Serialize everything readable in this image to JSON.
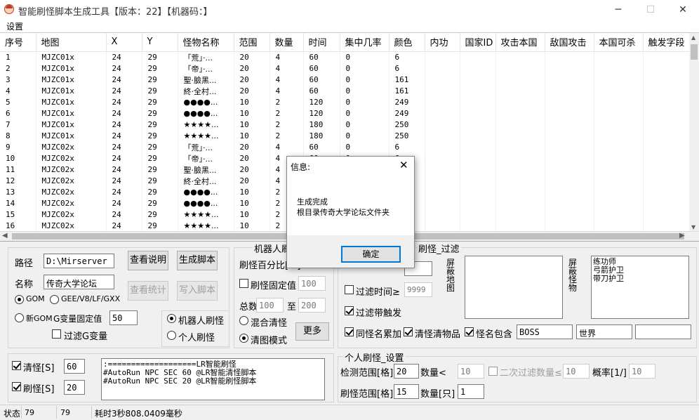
{
  "window": {
    "title": "智能刷怪脚本生成工具【版本：22】【机器码：】"
  },
  "menu": {
    "settings": "设置"
  },
  "table": {
    "columns": [
      "序号",
      "地图",
      "X",
      "Y",
      "怪物名称",
      "范围",
      "数量",
      "时间",
      "集中几率",
      "颜色",
      "内功",
      "国家ID",
      "攻击本国",
      "敌国攻击",
      "本国可杀",
      "触发字段"
    ],
    "rows": [
      [
        "1",
        "MJZC01x",
        "24",
        "29",
        "「荒」·...",
        "20",
        "4",
        "60",
        "0",
        "6"
      ],
      [
        "2",
        "MJZC01x",
        "24",
        "29",
        "「帝」·...",
        "20",
        "4",
        "60",
        "0",
        "6"
      ],
      [
        "3",
        "MJZC01x",
        "24",
        "29",
        "聖·臉黑...",
        "20",
        "4",
        "60",
        "0",
        "161"
      ],
      [
        "4",
        "MJZC01x",
        "24",
        "29",
        "終·全村...",
        "20",
        "4",
        "60",
        "0",
        "161"
      ],
      [
        "5",
        "MJZC01x",
        "24",
        "29",
        "●●●●...",
        "10",
        "2",
        "120",
        "0",
        "249"
      ],
      [
        "6",
        "MJZC01x",
        "24",
        "29",
        "●●●●...",
        "10",
        "2",
        "120",
        "0",
        "249"
      ],
      [
        "7",
        "MJZC01x",
        "24",
        "29",
        "★★★★...",
        "10",
        "2",
        "180",
        "0",
        "250"
      ],
      [
        "8",
        "MJZC01x",
        "24",
        "29",
        "★★★★...",
        "10",
        "2",
        "180",
        "0",
        "250"
      ],
      [
        "9",
        "MJZC02x",
        "24",
        "29",
        "「荒」·...",
        "20",
        "4",
        "60",
        "0",
        "6"
      ],
      [
        "10",
        "MJZC02x",
        "24",
        "29",
        "「帝」·...",
        "20",
        "4",
        "60",
        "0",
        "6"
      ],
      [
        "11",
        "MJZC02x",
        "24",
        "29",
        "聖·臉黑...",
        "20",
        "4",
        "60",
        "0",
        "161"
      ],
      [
        "12",
        "MJZC02x",
        "24",
        "29",
        "終·全村...",
        "20",
        "4",
        "60",
        "0",
        "161"
      ],
      [
        "13",
        "MJZC02x",
        "24",
        "29",
        "●●●●...",
        "10",
        "2",
        "120",
        "0",
        "249"
      ],
      [
        "14",
        "MJZC02x",
        "24",
        "29",
        "●●●●...",
        "10",
        "2",
        "120",
        "0",
        "249"
      ],
      [
        "15",
        "MJZC02x",
        "24",
        "29",
        "★★★★...",
        "10",
        "2",
        "180",
        "0",
        "250"
      ],
      [
        "16",
        "MJZC02x",
        "24",
        "29",
        "★★★★...",
        "10",
        "2",
        "180",
        "0",
        "250"
      ]
    ]
  },
  "config": {
    "path_label": "路径",
    "path_value": "D:\\Mirserver",
    "name_label": "名称",
    "name_value": "传奇大学论坛",
    "btn_view_help": "查看说明",
    "btn_gen_script": "生成脚本",
    "btn_stats": "查看统计",
    "btn_write_script": "写入脚本",
    "radio_gom": "GOM",
    "radio_gee": "GEE/V8/LF/GXX",
    "radio_new_gom": "新GOM",
    "gvar_label": "G变量固定值",
    "gvar_value": "50",
    "filter_gvar": "过滤G变量"
  },
  "robot": {
    "group_title": "机器人刷",
    "percent_label": "刷怪百分比[%]",
    "fixed_label": "刷怪固定值",
    "fixed_value": "100",
    "total_label": "总数",
    "total_min": "100",
    "to_label": "至",
    "total_max": "200",
    "mix_label": "混合清怪",
    "clear_label": "清图模式",
    "more_button": "更多",
    "radio_robot": "机器人刷怪",
    "radio_person": "个人刷怪"
  },
  "filter": {
    "group_title": "刷怪_过滤",
    "filter_time": "过滤时间≥",
    "filter_time_value": "9999",
    "filter_trigger": "过滤带触发",
    "same_name": "同怪名累加",
    "clear_items": "清怪清物品",
    "name_contains": "怪名包含",
    "contains1": "BOSS",
    "contains2": "世界",
    "contains3": "",
    "block_map_label": "屏蔽地图",
    "block_monster_label": "屏蔽怪物",
    "block_monsters": "练功师\n弓箭护卫\n带刀护卫"
  },
  "timers": {
    "clear_label": "清怪[S]",
    "clear_value": "60",
    "refresh_label": "刷怪[S]",
    "refresh_value": "20",
    "script_text": ":===================LR智能刷怪\n#AutoRun NPC SEC 60 @LR智能清怪脚本\n#AutoRun NPC SEC 20 @LR智能刷怪脚本"
  },
  "personal": {
    "group_title": "个人刷怪_设置",
    "detect_label": "检测范围[格]",
    "detect_value": "20",
    "count_lt_label": "数量<",
    "count_lt_value": "10",
    "second_filter_label": "二次过滤数量≤",
    "second_filter_value": "10",
    "prob_label": "概率[1/]",
    "prob_value": "10",
    "range_label": "刷怪范围[格]",
    "range_value": "15",
    "qty_label": "数量[只]",
    "qty_value": "1"
  },
  "dialog": {
    "title": "信息:",
    "line1": "生成完成",
    "line2": "根目录传奇大学论坛文件夹",
    "ok": "确定"
  },
  "status": {
    "label": "状态",
    "v1": "79",
    "v2": "79",
    "message": "耗时3秒808.0409毫秒"
  }
}
